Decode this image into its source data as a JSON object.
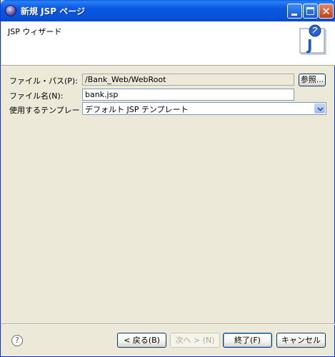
{
  "window": {
    "title": "新規 JSP ページ"
  },
  "header": {
    "title": "JSP ウィザード",
    "logo_letter": "J"
  },
  "form": {
    "path_label": "ファイル・パス(P):",
    "path_value": "/Bank_Web/WebRoot",
    "browse_label": "参照...",
    "name_label": "ファイル名(N):",
    "name_value": "bank.jsp",
    "template_label": "使用するテンプレート:",
    "template_value": "デフォルト JSP テンプレート"
  },
  "buttons": {
    "help": "?",
    "back": "< 戻る(B)",
    "next": "次へ > (N)",
    "finish": "終了(F)",
    "cancel": "キャンセル"
  },
  "colors": {
    "titlebar": "#0a58e0",
    "dialog_bg": "#ece9d8",
    "field_border": "#7f9db9",
    "button_border": "#003c74"
  }
}
